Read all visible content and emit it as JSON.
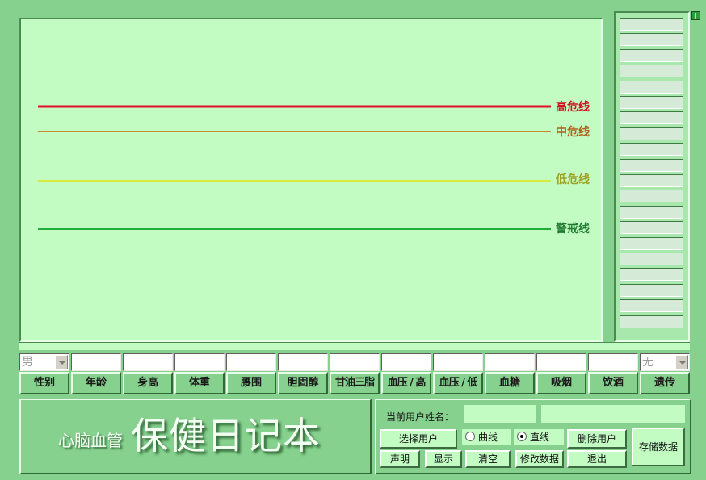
{
  "chart": {
    "lines": [
      {
        "label": "高危线",
        "color": "#e0102a",
        "label_color": "#d01020"
      },
      {
        "label": "中危线",
        "color": "#c88a2a",
        "label_color": "#b0601a"
      },
      {
        "label": "低危线",
        "color": "#d8ea3a",
        "label_color": "#a0a020"
      },
      {
        "label": "警戒线",
        "color": "#1fae3a",
        "label_color": "#207a30"
      }
    ]
  },
  "inputs": {
    "gender_value": "男",
    "heredity_value": "无"
  },
  "fields": [
    "性别",
    "年龄",
    "身高",
    "体重",
    "腰围",
    "胆固醇",
    "甘油三脂",
    "血压 / 高",
    "血压 / 低",
    "血糖",
    "吸烟",
    "饮酒",
    "遗传"
  ],
  "logo": {
    "small": "心脑血管",
    "big": "保健日记本"
  },
  "controls": {
    "current_user_label": "当前用户姓名：",
    "select_user": "选择用户",
    "mode_curve": "曲线",
    "mode_straight": "直线",
    "delete_user": "删除用户",
    "save_data": "存储数据",
    "statement": "声明",
    "show": "显示",
    "clear": "清空",
    "edit_data": "修改数据",
    "exit": "退出"
  },
  "colors": {
    "window_bg": "#86d18e",
    "chart_bg": "#c3fcc3"
  }
}
